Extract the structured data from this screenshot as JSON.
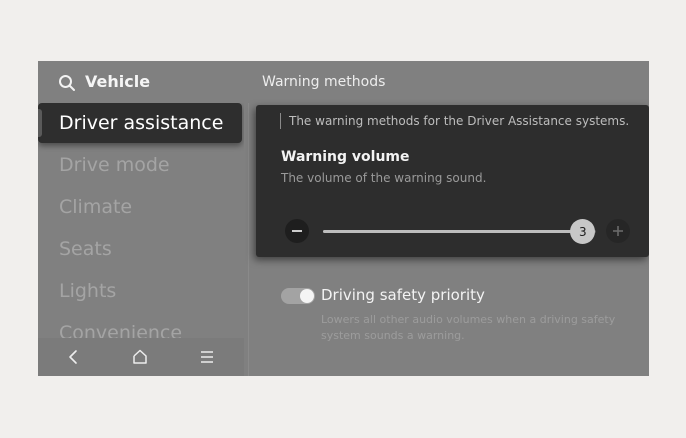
{
  "header": {
    "title": "Vehicle",
    "section_title": "Warning methods",
    "search_icon": "search-icon"
  },
  "sidebar": {
    "items": [
      {
        "label": "Driver assistance",
        "active": true
      },
      {
        "label": "Drive mode",
        "active": false
      },
      {
        "label": "Climate",
        "active": false
      },
      {
        "label": "Seats",
        "active": false
      },
      {
        "label": "Lights",
        "active": false
      },
      {
        "label": "Convenience",
        "active": false
      }
    ]
  },
  "bottom_nav": {
    "icons": [
      "back-icon",
      "home-icon",
      "menu-icon"
    ]
  },
  "panel": {
    "description": "The warning methods for the Driver Assistance systems.",
    "volume_title": "Warning volume",
    "volume_subtitle": "The volume of the warning sound.",
    "volume_value": "3",
    "volume_fraction": 0.95
  },
  "safety": {
    "label": "Driving safety priority",
    "description": "Lowers all other audio volumes when a driving safety system sounds a warning.",
    "enabled": true
  },
  "colors": {
    "screen_bg": "#808080",
    "active_item_bg": "#2e2e2e",
    "panel_bg": "#2d2d2d"
  }
}
